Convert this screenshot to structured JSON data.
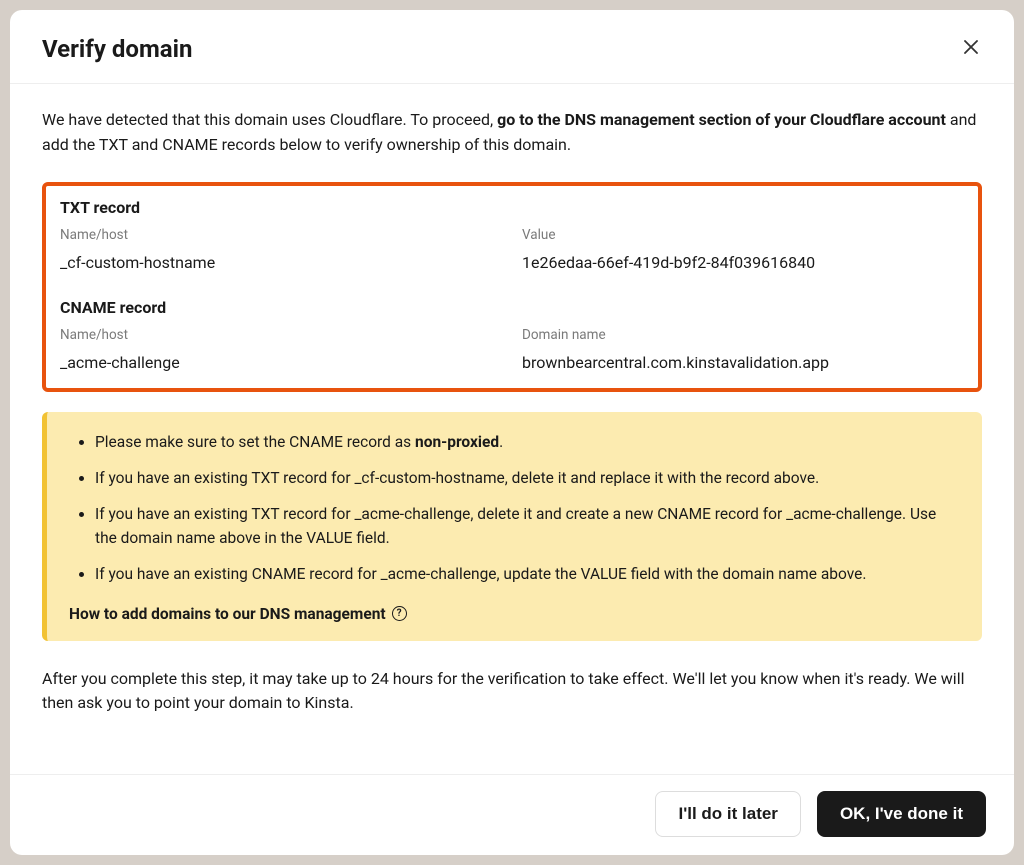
{
  "modal": {
    "title": "Verify domain",
    "intro_prefix": "We have detected that this domain uses Cloudflare. To proceed, ",
    "intro_bold": "go to the DNS management section of your Cloudflare account",
    "intro_suffix": " and add the TXT and CNAME records below to verify ownership of this domain.",
    "txt_record": {
      "title": "TXT record",
      "name_label": "Name/host",
      "name_value": "_cf-custom-hostname",
      "value_label": "Value",
      "value_value": "1e26edaa-66ef-419d-b9f2-84f039616840"
    },
    "cname_record": {
      "title": "CNAME record",
      "name_label": "Name/host",
      "name_value": "_acme-challenge",
      "domain_label": "Domain name",
      "domain_value": "brownbearcentral.com.kinstavalidation.app"
    },
    "callout": {
      "bullet1_prefix": "Please make sure to set the CNAME record as ",
      "bullet1_bold": "non-proxied",
      "bullet1_suffix": ".",
      "bullet2": "If you have an existing TXT record for _cf-custom-hostname, delete it and replace it with the record above.",
      "bullet3": "If you have an existing TXT record for _acme-challenge, delete it and create a new CNAME record for _acme-challenge. Use the domain name above in the VALUE field.",
      "bullet4": "If you have an existing CNAME record for _acme-challenge, update the VALUE field with the domain name above.",
      "help_link": "How to add domains to our DNS management"
    },
    "closing_text": "After you complete this step, it may take up to 24 hours for the verification to take effect. We'll let you know when it's ready. We will then ask you to point your domain to Kinsta.",
    "buttons": {
      "later": "I'll do it later",
      "done": "OK, I've done it"
    }
  }
}
